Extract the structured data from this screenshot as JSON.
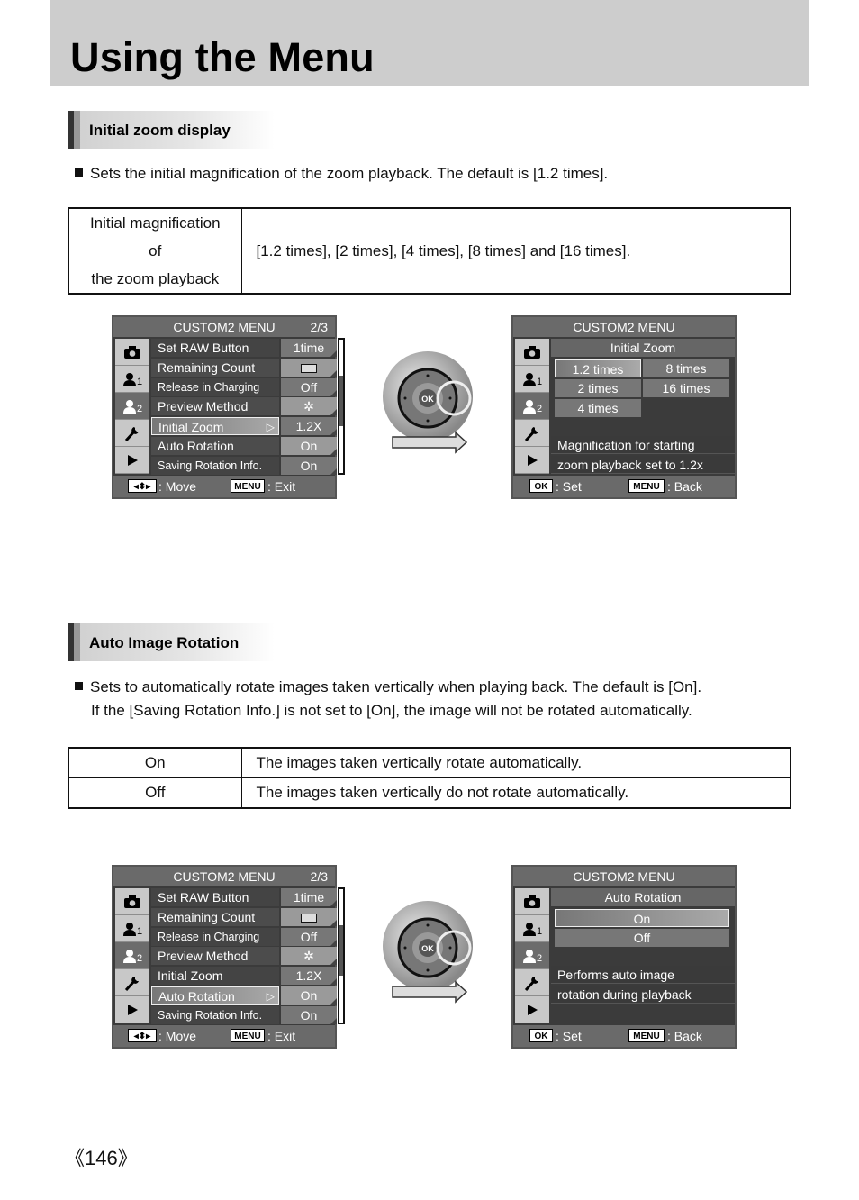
{
  "page_title": "Using the Menu",
  "page_number": "《146》",
  "sections": [
    {
      "heading": "Initial zoom display",
      "bullets": [
        "Sets the initial magnification of the zoom playback. The default is [1.2 times]."
      ],
      "table": [
        {
          "key_line1": "Initial magnification of",
          "key_line2": "the zoom playback",
          "value": "[1.2 times], [2 times], [4 times], [8 times] and [16 times]."
        }
      ],
      "menu_left": {
        "title": "CUSTOM2 MENU",
        "page": "2/3",
        "rows": [
          {
            "label": "Set RAW Button",
            "value": "1time"
          },
          {
            "label": "Remaining Count",
            "value": "[box-icon]"
          },
          {
            "label": "Release in Charging",
            "value": "Off"
          },
          {
            "label": "Preview Method",
            "value": "✲"
          },
          {
            "label": "Initial Zoom",
            "value": "1.2X"
          },
          {
            "label": "Auto Rotation",
            "value": "On"
          },
          {
            "label": "Saving Rotation Info.",
            "value": "On"
          }
        ],
        "selected": "Initial Zoom",
        "footer_key1": "◂⬍▸",
        "footer_text1": ": Move",
        "footer_key2": "MENU",
        "footer_text2": ": Exit"
      },
      "menu_right": {
        "title": "CUSTOM2 MENU",
        "subtitle": "Initial Zoom",
        "options": [
          "1.2 times",
          "8 times",
          "2 times",
          "16 times",
          "4 times"
        ],
        "selected": "1.2 times",
        "description": [
          "Magnification for starting",
          "zoom playback set to 1.2x"
        ],
        "footer_key1": "OK",
        "footer_text1": ": Set",
        "footer_key2": "MENU",
        "footer_text2": ": Back"
      }
    },
    {
      "heading": "Auto Image Rotation",
      "bullets": [
        "Sets to automatically rotate images taken vertically when playing back. The default is [On].",
        "If the [Saving Rotation Info.] is not set to [On], the image will not be rotated automatically."
      ],
      "table": [
        {
          "key": "On",
          "value": "The images taken vertically rotate automatically."
        },
        {
          "key": "Off",
          "value": "The images taken vertically do not rotate automatically."
        }
      ],
      "menu_left": {
        "title": "CUSTOM2 MENU",
        "page": "2/3",
        "rows": [
          {
            "label": "Set RAW Button",
            "value": "1time"
          },
          {
            "label": "Remaining Count",
            "value": "[box-icon]"
          },
          {
            "label": "Release in Charging",
            "value": "Off"
          },
          {
            "label": "Preview Method",
            "value": "✲"
          },
          {
            "label": "Initial Zoom",
            "value": "1.2X"
          },
          {
            "label": "Auto Rotation",
            "value": "On"
          },
          {
            "label": "Saving Rotation Info.",
            "value": "On"
          }
        ],
        "selected": "Auto Rotation",
        "footer_key1": "◂⬍▸",
        "footer_text1": ": Move",
        "footer_key2": "MENU",
        "footer_text2": ": Exit"
      },
      "menu_right": {
        "title": "CUSTOM2 MENU",
        "subtitle": "Auto Rotation",
        "options": [
          "On",
          "Off"
        ],
        "selected": "On",
        "description": [
          "Performs auto image",
          "rotation during playback"
        ],
        "footer_key1": "OK",
        "footer_text1": ": Set",
        "footer_key2": "MENU",
        "footer_text2": ": Back"
      }
    }
  ],
  "dial": {
    "center_label": "OK"
  },
  "side_icons": [
    "camera-icon",
    "user1-icon",
    "user2-icon",
    "wrench-icon",
    "play-icon"
  ],
  "side_icon_labels": {
    "user1_sub": "1",
    "user2_sub": "2"
  }
}
